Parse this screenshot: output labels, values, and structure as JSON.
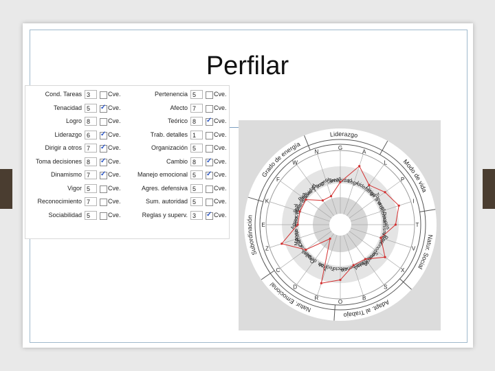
{
  "title": "Perfilar",
  "checkbox_label": "Cve.",
  "left_column": [
    {
      "label": "Cond. Tareas",
      "value": "3",
      "checked": false
    },
    {
      "label": "Tenacidad",
      "value": "5",
      "checked": true
    },
    {
      "label": "Logro",
      "value": "8",
      "checked": false
    },
    {
      "label": "Liderazgo",
      "value": "6",
      "checked": true
    },
    {
      "label": "Dirigir a otros",
      "value": "7",
      "checked": true
    },
    {
      "label": "Toma decisiones",
      "value": "8",
      "checked": true
    },
    {
      "label": "Dinamismo",
      "value": "7",
      "checked": true
    },
    {
      "label": "Vigor",
      "value": "5",
      "checked": false
    },
    {
      "label": "Reconocimiento",
      "value": "7",
      "checked": false
    },
    {
      "label": "Sociabilidad",
      "value": "5",
      "checked": false
    }
  ],
  "right_column": [
    {
      "label": "Pertenencia",
      "value": "5",
      "checked": false
    },
    {
      "label": "Afecto",
      "value": "7",
      "checked": false
    },
    {
      "label": "Teórico",
      "value": "8",
      "checked": true
    },
    {
      "label": "Trab. detalles",
      "value": "1",
      "checked": false
    },
    {
      "label": "Organización",
      "value": "5",
      "checked": false
    },
    {
      "label": "Cambio",
      "value": "8",
      "checked": true
    },
    {
      "label": "Manejo emocional",
      "value": "5",
      "checked": true
    },
    {
      "label": "Agres. defensiva",
      "value": "5",
      "checked": false
    },
    {
      "label": "Sum. autoridad",
      "value": "5",
      "checked": false
    },
    {
      "label": "Reglas y superv.",
      "value": "3",
      "checked": true
    }
  ],
  "wheel": {
    "outer_labels": [
      "Grado de energía",
      "Liderazgo",
      "Modo de vida",
      "Natur. Social",
      "Adapt. al Trabajo",
      "Natur. Emocional",
      "Subordinación"
    ],
    "letters": [
      "G",
      "A",
      "L",
      "P",
      "I",
      "T",
      "V",
      "X",
      "S",
      "B",
      "O",
      "R",
      "D",
      "C",
      "Z",
      "E",
      "K",
      "F",
      "W",
      "N"
    ],
    "spokes": [
      "Tenacidad",
      "Logro",
      "Liderazgo",
      "Dirigir a otros",
      "Toma decisiones",
      "Dinamismo",
      "Vigor",
      "Reconocimiento",
      "Sociabilidad",
      "Pertenencia",
      "Afecto",
      "Teórico",
      "Trab. detalles",
      "Organización",
      "Cambio",
      "Manejo emocional",
      "Agres. defensiva",
      "Sum. autoridad",
      "Reglas y superv.",
      "Cond. Tareas"
    ],
    "profile": [
      5,
      8,
      6,
      7,
      8,
      7,
      5,
      7,
      5,
      5,
      7,
      8,
      1,
      5,
      8,
      5,
      5,
      5,
      3,
      3
    ],
    "colors": {
      "profile": "#d33030",
      "ring": "#555555"
    }
  }
}
